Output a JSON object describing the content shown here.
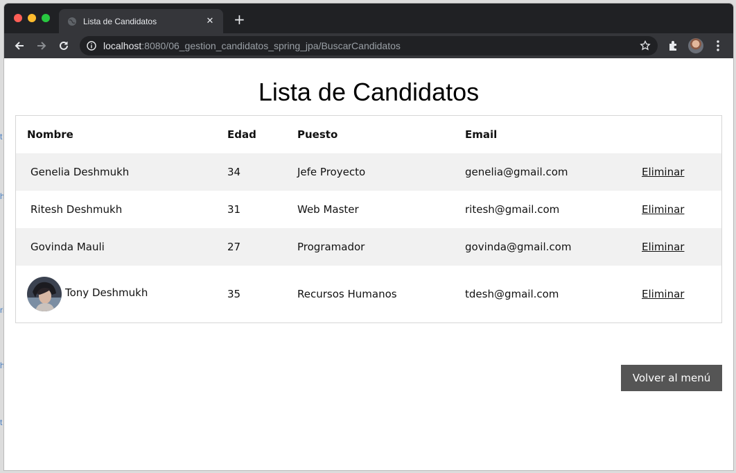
{
  "browser": {
    "tab_title": "Lista de Candidatos",
    "tab_close_glyph": "✕",
    "new_tab_glyph": "+",
    "url_host": "localhost",
    "url_path": ":8080/06_gestion_candidatos_spring_jpa/BuscarCandidatos",
    "icons": [
      "back-arrow-icon",
      "forward-arrow-icon",
      "reload-icon",
      "info-icon",
      "star-icon",
      "extensions-icon",
      "profile-avatar",
      "menu-icon"
    ]
  },
  "page": {
    "title": "Lista de Candidatos",
    "table": {
      "headers": [
        "Nombre",
        "Edad",
        "Puesto",
        "Email",
        ""
      ],
      "rows": [
        {
          "nombre": "Genelia Deshmukh",
          "edad": "34",
          "puesto": "Jefe Proyecto",
          "email": "genelia@gmail.com",
          "accion": "Eliminar",
          "has_photo": false
        },
        {
          "nombre": "Ritesh Deshmukh",
          "edad": "31",
          "puesto": "Web Master",
          "email": "ritesh@gmail.com",
          "accion": "Eliminar",
          "has_photo": false
        },
        {
          "nombre": "Govinda Mauli",
          "edad": "27",
          "puesto": "Programador",
          "email": "govinda@gmail.com",
          "accion": "Eliminar",
          "has_photo": false
        },
        {
          "nombre": "Tony Deshmukh",
          "edad": "35",
          "puesto": "Recursos Humanos",
          "email": "tdesh@gmail.com",
          "accion": "Eliminar",
          "has_photo": true
        }
      ]
    },
    "back_button": "Volver al menú"
  },
  "colors": {
    "browser_frame": "#202124",
    "toolbar": "#35363a",
    "row_shade": "#f1f1f1",
    "button_bg": "#555555"
  }
}
